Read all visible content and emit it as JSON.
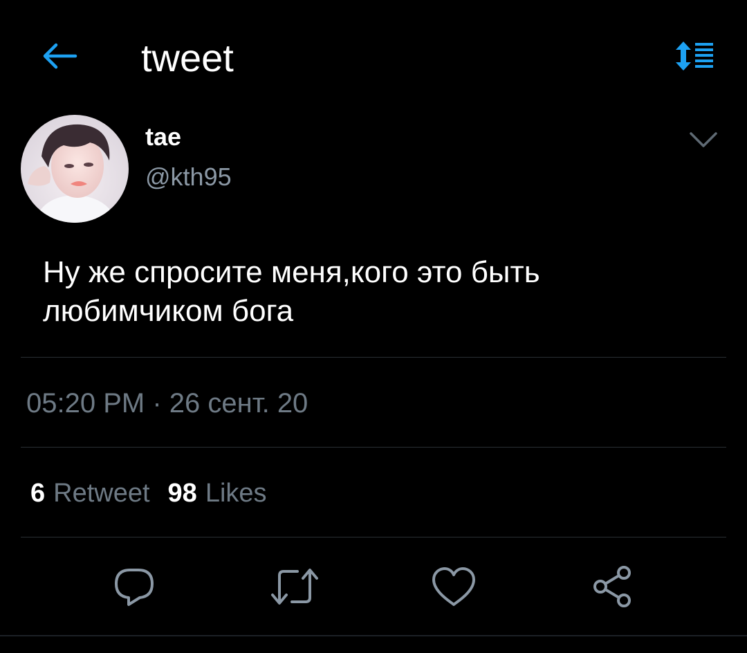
{
  "header": {
    "title": "tweet",
    "back_icon": "arrow-left-icon",
    "sort_icon": "sort-list-icon",
    "accent_color": "#1da1f2"
  },
  "tweet": {
    "author_name": "tae",
    "author_handle": "@kth95",
    "text": "Ну же спросите меня,кого это быть любимчиком бога",
    "timestamp": "05:20 PM · 26 сент. 20",
    "retweet_count": "6",
    "retweet_label": "Retweet",
    "like_count": "98",
    "like_label": "Likes"
  },
  "actions": {
    "icons": [
      "reply-icon",
      "retweet-icon",
      "like-icon",
      "share-icon"
    ],
    "icon_color": "#8b98a5"
  }
}
